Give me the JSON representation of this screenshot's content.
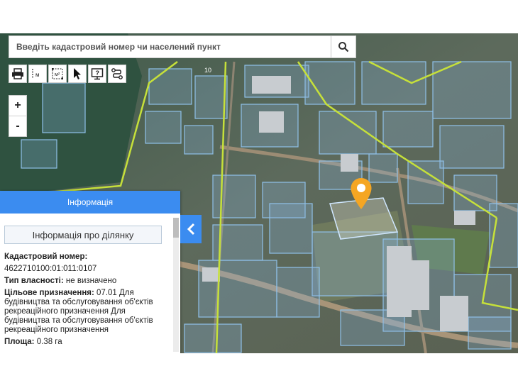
{
  "search": {
    "placeholder": "Введіть кадастровий номер чи населений пункт"
  },
  "toolbar": {
    "measure_line_label": "м",
    "measure_area_label": "м²"
  },
  "zoom": {
    "in_label": "+",
    "out_label": "-"
  },
  "map": {
    "label_road": "10"
  },
  "panel": {
    "header": "Інформація",
    "title": "Інформація про ділянку",
    "cadastral_label": "Кадастровий номер:",
    "cadastral_value": "4622710100:01:011:0107",
    "ownership_label": "Тип власності:",
    "ownership_value": "не визначено",
    "purpose_label": "Цільове призначення:",
    "purpose_value": "07.01 Для будівництва та обслуговування об'єктів рекреаційного призначення Для будівництва та обслуговування об'єктів рекреаційного призначення",
    "area_label": "Площа:",
    "area_value": "0.38 га"
  },
  "colors": {
    "accent": "#3b8cf0",
    "marker": "#f5a623",
    "parcel": "#7fb2d8",
    "boundary": "#c6e03a"
  }
}
